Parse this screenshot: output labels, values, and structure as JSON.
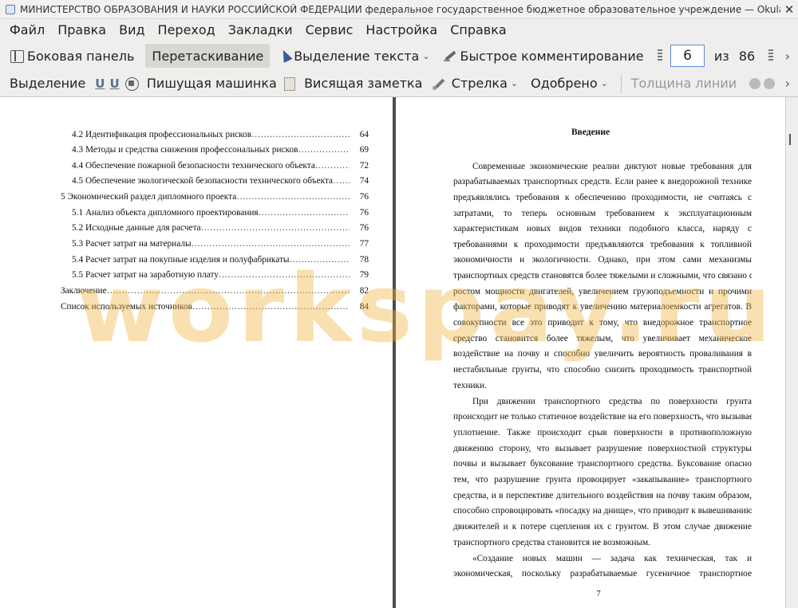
{
  "window": {
    "title": "МИНИСТЕРСТВО ОБРАЗОВАНИЯ И НАУКИ РОССИЙСКОЙ ФЕДЕРАЦИИ федеральное государственное бюджетное образовательное учреждение  — Okular",
    "close_glyph": "✕"
  },
  "menubar": [
    "Файл",
    "Правка",
    "Вид",
    "Переход",
    "Закладки",
    "Сервис",
    "Настройка",
    "Справка"
  ],
  "toolbar1": {
    "sidebar": "Боковая панель",
    "drag": "Перетаскивание",
    "text_select": "Выделение текста",
    "quick_comment": "Быстрое комментирование",
    "page_current": "6",
    "of_label": "из",
    "page_total": "86",
    "more": "›"
  },
  "toolbar2": {
    "highlight": "Выделение",
    "typewriter": "Пишущая машинка",
    "sticky_note": "Висящая заметка",
    "arrow": "Стрелка",
    "approved": "Одобрено",
    "line_width": "Толщина линии",
    "more": "›"
  },
  "toc": [
    {
      "text": "4.2 Идентификация профессиональных рисков",
      "page": "64"
    },
    {
      "text": "4.3 Методы и средства снижения профессональных рисков",
      "page": "69"
    },
    {
      "text": "4.4 Обеспечение пожарной безопасности технического объекта",
      "page": "72"
    },
    {
      "text": "4.5 Обеспечение экологической безопасности технического объекта",
      "page": "74"
    },
    {
      "text": "5 Экономический раздел дипломного проекта",
      "page": "76"
    },
    {
      "text": "5.1 Анализ объекта дипломного проектирования",
      "page": "76"
    },
    {
      "text": "5.2 Исходные данные для расчета",
      "page": "76"
    },
    {
      "text": "5.3 Расчет затрат на материалы",
      "page": "77"
    },
    {
      "text": "5.4 Расчет затрат на покупные изделия и полуфабрикаты",
      "page": "78"
    },
    {
      "text": "5.5 Расчет затрат на заработную плату",
      "page": "79"
    },
    {
      "text": "Заключение",
      "page": "82"
    },
    {
      "text": "Список используемых источников",
      "page": "84"
    }
  ],
  "right_page": {
    "heading": "Введение",
    "lines": [
      "Современные экономические реалии диктуют новые требования для",
      "разрабатываемых транспортных средств. Если ранее к внедорожной технике",
      "предъявлялись требования к обеспечению проходимости, не считаясь с",
      "затратами, то теперь основным требованием к эксплуатационным",
      "характеристикам новых видов техники подобного класса, наряду с",
      "требованиями к проходимости предъявляются требования к топливной",
      "экономичности и экологичности. Однако, при этом сами механизмы",
      "транспортных средств становятся более тяжелыми и сложными, что связано с",
      "ростом мощности двигателей, увеличением грузоподъемности и прочими",
      "факторами, которые приводят к увеличению материалоемкости агрегатов. В",
      "совокупности все это приводит к тому, что внедорожное транспортное",
      "средство становится более тяжелым, что увеличивает механическое",
      "воздействие на почву и способно увеличить вероятность проваливания в",
      "нестабильные грунты, что способно снизить проходимость транспортной",
      "техники.",
      "При движении транспортного средства по поверхности грунта",
      "происходит не только статичное воздействие на его поверхность, что вызывает",
      "уплотнение. Также происходит срыв поверхности в противоположную",
      "движению сторону, что вызывает разрушение поверхностной структуры",
      "почвы и вызывает буксование транспортного средства. Буксование опасно",
      "тем, что разрушение грунта провоцирует «закапывание» транспортного",
      "средства, и в перспективе длительного воздействия на почву таким образом,",
      "способно спровоцировать «посадку на днище», что приводит к вывешиванию",
      "движителей и к потере сцепления их с грунтом. В этом случае движение",
      "транспортного средства становится не возможным.",
      "«Создание новых машин — задача как техническая, так и",
      "экономическая, поскольку разрабатываемые гусеничное транспортное"
    ],
    "page_number": "7"
  },
  "watermark": "workspay.ru"
}
